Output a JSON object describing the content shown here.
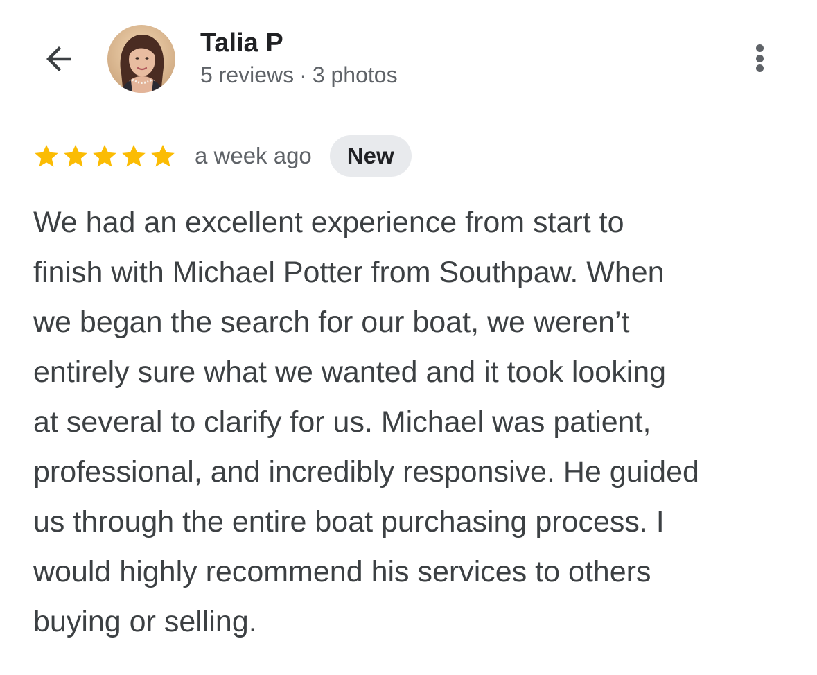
{
  "header": {
    "back_icon": "arrow-back-icon",
    "more_icon": "more-vert-icon",
    "reviewer": {
      "name": "Talia P",
      "reviews_count": "5 reviews",
      "separator": "·",
      "photos_count": "3 photos"
    }
  },
  "review": {
    "rating": 5,
    "rating_max": 5,
    "star_color": "#fbbc04",
    "time_ago": "a week ago",
    "badge": "New",
    "text_lines": [
      "We had an excellent experience from start to",
      "finish with Michael Potter from Southpaw. When",
      "we began the search for our boat, we weren’t",
      "entirely sure what we wanted and it took looking",
      "at several to clarify for us. Michael was patient,",
      "professional, and incredibly responsive. He guided",
      "us through the entire boat purchasing process. I",
      "would highly recommend his services to others",
      "buying or selling."
    ]
  }
}
